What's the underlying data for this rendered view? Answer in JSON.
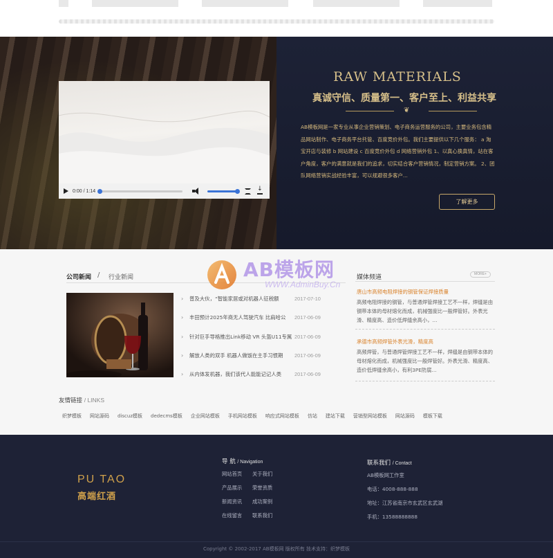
{
  "hero": {
    "title": "RAW MATERIALS",
    "subtitle": "真诚守信、质量第一、客户至上、利益共享",
    "description": "AB模板网是一家专业从事企业营销策划、电子商务运营服务的公司，主要业务包含精品网站制作、电子商务平台托管、百度竞价外包。我们主要提供以下几个服务： a 淘宝开店与装修 b 网站建设 c 百度竞价外包 d 网络营销外包 1、以真心换真情，站在客户角度，客户的满意就是我们的追求，切实结合客户营销情况，制定营销方案。 2、团队网络营销实战经验丰富，可以规避很多客户...",
    "more_label": "了解更多",
    "video": {
      "time": "0:00 / 1:14",
      "progress": 0.0,
      "volume": 1.0
    }
  },
  "news": {
    "tab_active": "公司新闻",
    "separator": "/",
    "tab_other": "行业新闻",
    "items": [
      {
        "title": "普及大伙，“智能家居或对机器人征税额",
        "date": "2017-07-10"
      },
      {
        "title": "丰田预计2025年商无人驾驶汽车 比肩哈公",
        "date": "2017-06-09"
      },
      {
        "title": "针对巨手导格推出Link移动 VR 头盔U11专属",
        "date": "2017-06-09"
      },
      {
        "title": "解放人类的双手 机器人做饭在主手习惯期",
        "date": "2017-06-09"
      },
      {
        "title": "从内体发机器，我们该代人能能记记人类",
        "date": "2017-06-09"
      }
    ]
  },
  "media": {
    "title": "媒体频道",
    "more": "MORE+",
    "items": [
      {
        "title": "唐山市高频电阻焊接的钢管保证焊接质量",
        "text": "高频电阻焊接的钢管，与普通焊管焊接工艺不一样，焊缝是由钢带本体的母材熔化而成，机械强度比一般焊管好。外表光滑、精度高、造价低焊缝余高小，..."
      },
      {
        "title": "承德市高频焊管外表光滑，精度高",
        "text": "高频焊管，与普通焊管焊接工艺不一样，焊缝是由钢带本体的母材熔化而成，机械强度比一般焊管好。外表光滑、精度高、造价低焊缝余高小，有利3PE防腐..."
      }
    ]
  },
  "watermark": {
    "text": "AB模板网",
    "url": "WWW.AdminBuy.Cn"
  },
  "links": {
    "title": "友情链接",
    "title_en": "/ LINKS",
    "items": [
      "织梦模板",
      "网站源码",
      "discuz模板",
      "dedecms模板",
      "企业网站模板",
      "手机网站模板",
      "响应式网站模板",
      "仿站",
      "建站下载",
      "营销型网站模板",
      "网站源码",
      "模板下载"
    ]
  },
  "footer": {
    "brand_en": "PU TAO",
    "brand_cn": "高端红酒",
    "nav_title": "导 航",
    "nav_title_en": "/ Navigation",
    "nav_items": [
      "网站首页",
      "关于我们",
      "产品展示",
      "荣誉资质",
      "新闻资讯",
      "成功案例",
      "在线留言",
      "联系我们"
    ],
    "contact_title": "联系我们",
    "contact_title_en": "/ Contact",
    "contact_items": [
      "AB模板网工作室",
      "电话：4008-888-888",
      "地址：江苏省南京市玄武区玄武湖",
      "手机：13588888888"
    ],
    "copyright": "Copyright © 2002-2017 AB模板网 版权所有 技术支持：织梦模板"
  }
}
